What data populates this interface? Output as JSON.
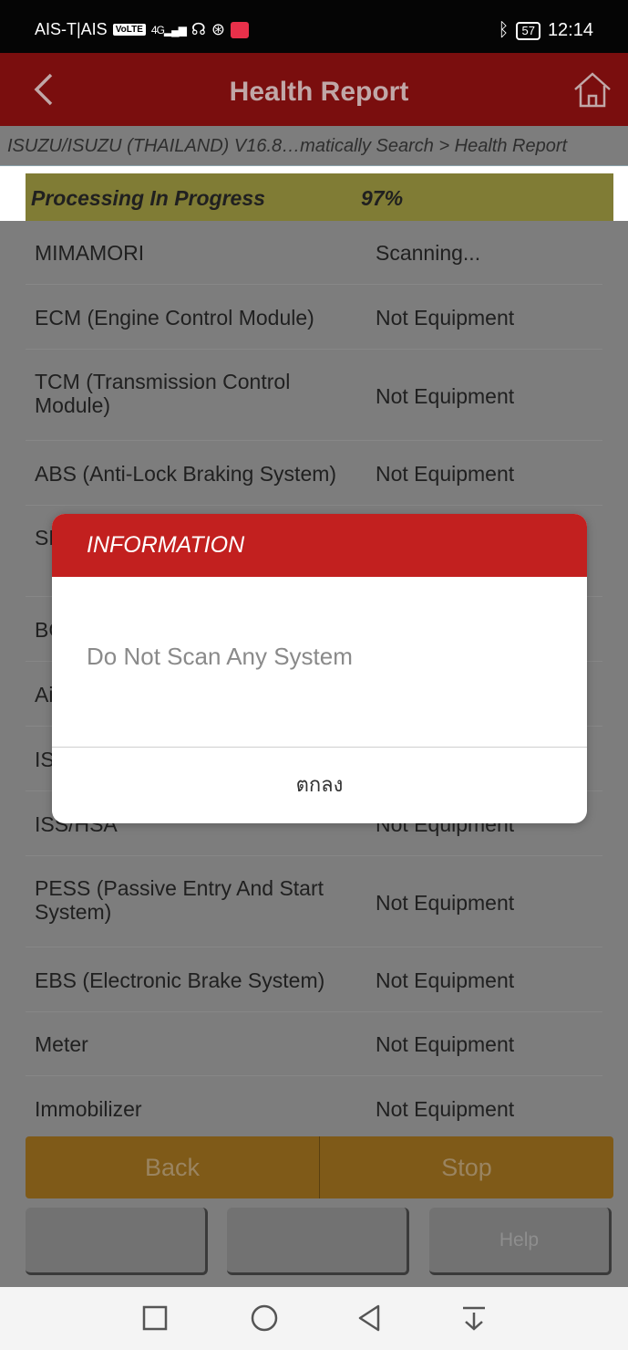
{
  "status_bar": {
    "carrier": "AIS-T|AIS",
    "volte": "VoLTE",
    "signal": "4G",
    "battery": "57",
    "time": "12:14"
  },
  "header": {
    "title": "Health Report"
  },
  "breadcrumb": "ISUZU/ISUZU (THAILAND) V16.8…matically Search > Health Report",
  "progress": {
    "label": "Processing In Progress",
    "percent": "97%"
  },
  "systems": [
    {
      "name": "MIMAMORI",
      "status": "Scanning..."
    },
    {
      "name": "ECM (Engine Control Module)",
      "status": "Not Equipment"
    },
    {
      "name": "TCM (Transmission Control Module)",
      "status": "Not Equipment"
    },
    {
      "name": "ABS (Anti-Lock Braking System)",
      "status": "Not Equipment"
    },
    {
      "name": "SR",
      "status": ""
    },
    {
      "name": "BC",
      "status": ""
    },
    {
      "name": "Ai",
      "status": ""
    },
    {
      "name": "IS",
      "status": ""
    },
    {
      "name": "ISS/HSA",
      "status": "Not Equipment"
    },
    {
      "name": "PESS (Passive Entry And Start System)",
      "status": "Not Equipment"
    },
    {
      "name": "EBS (Electronic Brake System)",
      "status": "Not Equipment"
    },
    {
      "name": "Meter",
      "status": "Not Equipment"
    },
    {
      "name": "Immobilizer",
      "status": "Not Equipment"
    }
  ],
  "actions": {
    "back": "Back",
    "stop": "Stop"
  },
  "secondary": {
    "btn1": "",
    "btn2": "",
    "help": "Help"
  },
  "dialog": {
    "title": "INFORMATION",
    "message": "Do Not Scan Any System",
    "ok": "ตกลง"
  },
  "colors": {
    "header": "#7a0e0e",
    "dialog_header": "#c2201f",
    "progress_bar": "#807c35",
    "action_bar": "#7f5a18"
  }
}
